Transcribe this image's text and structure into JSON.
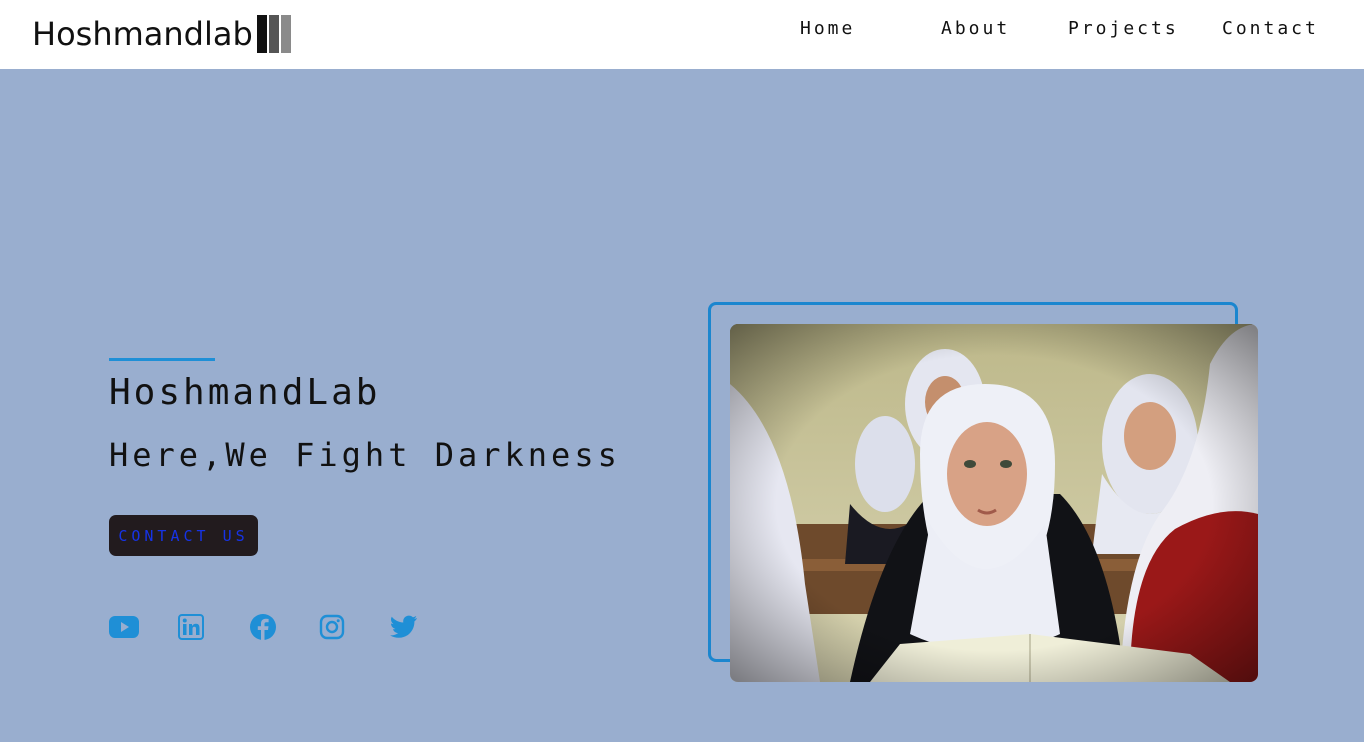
{
  "header": {
    "logo_text": "Hoshmandlab",
    "logo_bar_colors": [
      "#111111",
      "#555555",
      "#8a8a8a"
    ],
    "nav": [
      {
        "label": "Home"
      },
      {
        "label": "About"
      },
      {
        "label": "Projects"
      },
      {
        "label": "Contact"
      }
    ]
  },
  "hero": {
    "title": "HoshmandLab",
    "subtitle": "Here,We Fight Darkness",
    "cta_label": "CONTACT US",
    "social_icons": [
      "youtube-icon",
      "linkedin-icon",
      "facebook-icon",
      "instagram-icon",
      "twitter-icon"
    ],
    "image_description_icon": "photo-students-classroom"
  },
  "colors": {
    "background": "#99aecf",
    "header_bg": "#ffffff",
    "accent": "#1f8fd6",
    "cta_bg": "#221b1e",
    "cta_text": "#1633e6"
  }
}
